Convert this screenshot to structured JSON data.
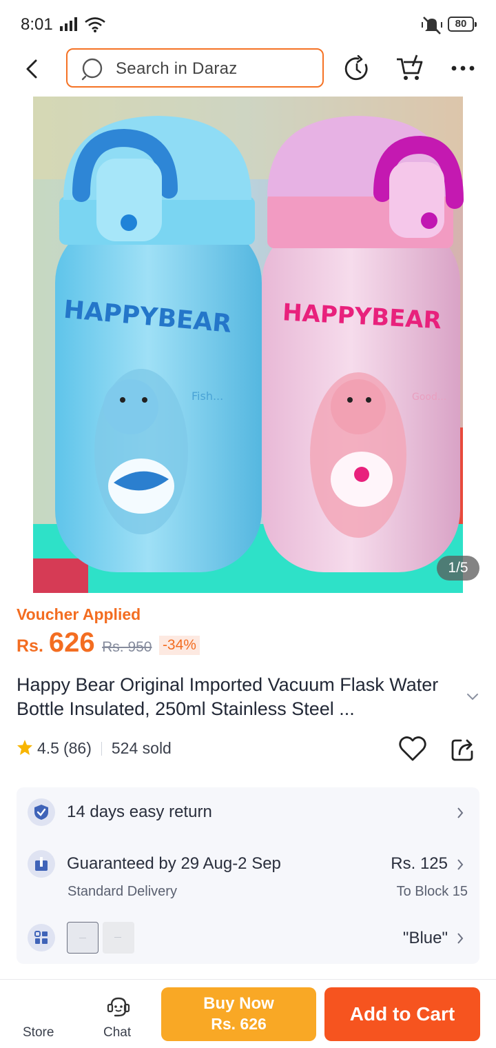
{
  "status_bar": {
    "time": "8:01",
    "battery": "80",
    "icons": [
      "signal-icon",
      "wifi-icon",
      "mute-icon",
      "battery-icon"
    ]
  },
  "header": {
    "search_placeholder": "Search in Daraz",
    "icons": [
      "back-icon",
      "search-icon",
      "history-icon",
      "cart-icon",
      "more-icon"
    ]
  },
  "product_image": {
    "counter": "1/5",
    "bottles": [
      {
        "brand_text": "HAPPYBEAR",
        "caption": "Fish...",
        "color": "#7fd3f0"
      },
      {
        "brand_text": "HAPPYBEAR",
        "caption": "Good...",
        "color": "#f2c3dc"
      }
    ]
  },
  "pricing": {
    "voucher": "Voucher Applied",
    "currency": "Rs.",
    "price": "626",
    "old_price": "Rs. 950",
    "discount": "-34%"
  },
  "product": {
    "title": "Happy Bear Original Imported Vacuum Flask Water Bottle Insulated, 250ml Stainless Steel ...",
    "rating": "4.5",
    "reviews": "(86)",
    "sold": "524 sold"
  },
  "info": {
    "return": "14 days easy return",
    "delivery": "Guaranteed by 29 Aug-2 Sep",
    "delivery_type": "Standard Delivery",
    "delivery_fee": "Rs. 125",
    "delivery_location": "To Block 15",
    "variant": "\"Blue\""
  },
  "bottom_bar": {
    "store": "Store",
    "chat": "Chat",
    "buy_now": "Buy Now",
    "buy_now_price": "Rs. 626",
    "add_to_cart": "Add to Cart"
  },
  "colors": {
    "accent": "#f36d21",
    "buy_now": "#f9a825",
    "add_to_cart": "#f6541f",
    "star": "#f8b500"
  }
}
